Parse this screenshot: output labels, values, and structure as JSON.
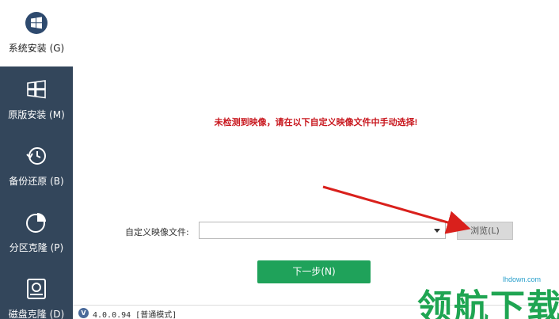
{
  "sidebar": {
    "items": [
      {
        "label": "系统安装 (G)",
        "icon": "windows-circle-icon",
        "active": true
      },
      {
        "label": "原版安装 (M)",
        "icon": "windows-logo-icon",
        "active": false
      },
      {
        "label": "备份还原 (B)",
        "icon": "clock-restore-icon",
        "active": false
      },
      {
        "label": "分区克隆 (P)",
        "icon": "pie-chart-icon",
        "active": false
      },
      {
        "label": "磁盘克隆 (D)",
        "icon": "disk-icon",
        "active": false
      }
    ]
  },
  "main": {
    "warning": "未检测到映像，请在以下自定义映像文件中手动选择!",
    "file_label": "自定义映像文件:",
    "file_value": "",
    "browse_label": "浏览(L)",
    "next_label": "下一步(N)"
  },
  "status": {
    "version_icon": "V",
    "version_text": "4.0.0.94 [普通模式]"
  },
  "watermark": {
    "text": "领航下载",
    "url": "lhdown.com"
  },
  "colors": {
    "sidebar": "#33465b",
    "warning": "#c8161d",
    "next_button": "#1fa25a",
    "watermark": "#1fa552"
  }
}
